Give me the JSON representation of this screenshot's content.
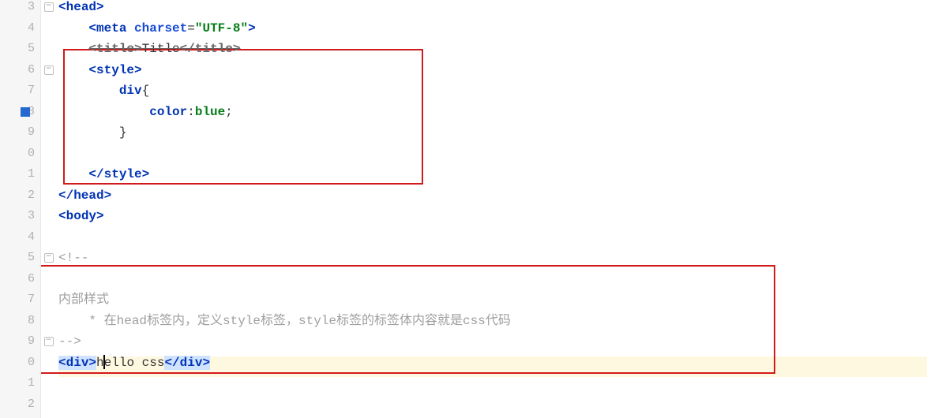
{
  "lineNumbers": [
    "3",
    "4",
    "5",
    "6",
    "7",
    "8",
    "9",
    "0",
    "1",
    "2",
    "3",
    "4",
    "5",
    "6",
    "7",
    "8",
    "9",
    "0",
    "1",
    "2"
  ],
  "code": {
    "l3": {
      "indent": "",
      "t": "head"
    },
    "l4": {
      "indent": "    ",
      "t": "meta",
      "a": "charset",
      "v": "\"UTF-8\""
    },
    "l5": {
      "indent": "    ",
      "open": "<title>",
      "txt": "Title",
      "close": "</title>"
    },
    "l6": {
      "indent": "    ",
      "t": "style"
    },
    "l7": {
      "indent": "        ",
      "sel": "div",
      "brace": "{"
    },
    "l8": {
      "indent": "            ",
      "prop": "color",
      "val": "blue",
      "semi": ";"
    },
    "l9": {
      "indent": "        ",
      "brace": "}"
    },
    "l11": {
      "indent": "    ",
      "t": "style"
    },
    "l12": {
      "indent": "",
      "t": "head"
    },
    "l13": {
      "indent": "",
      "t": "body"
    },
    "l15": {
      "txt": "<!--"
    },
    "l17": {
      "txt": "内部样式"
    },
    "l18": {
      "txt": "    * 在head标签内，定义style标签，style标签的标签体内容就是css代码"
    },
    "l19": {
      "txt": "-->"
    },
    "l20": {
      "open": "<div>",
      "txt_before": "h",
      "txt_after": "ello css",
      "close": "</div>"
    }
  },
  "caretLine": 20,
  "breakpointLine": 8
}
